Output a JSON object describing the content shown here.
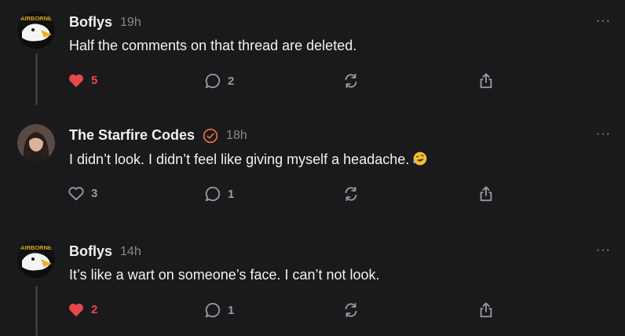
{
  "posts": [
    {
      "author": "Boflys",
      "time": "19h",
      "verified": false,
      "text": "Half the comments on that thread are deleted.",
      "avatar": {
        "type": "logo",
        "text": "AIRBORNE",
        "icon": "eagle-icon"
      },
      "likes": "5",
      "liked": true,
      "comments": "2",
      "emoji": null
    },
    {
      "author": "The Starfire Codes",
      "time": "18h",
      "verified": true,
      "text": "I didn’t look. I didn’t feel like giving myself a headache.",
      "avatar": {
        "type": "photo",
        "icon": "user-photo"
      },
      "likes": "3",
      "liked": false,
      "comments": "1",
      "emoji": "rolling-on-floor-laughing-emoji"
    },
    {
      "author": "Boflys",
      "time": "14h",
      "verified": false,
      "text": "It’s like a wart on someone’s face. I can’t not look.",
      "avatar": {
        "type": "logo",
        "text": "AIRBORNE",
        "icon": "eagle-icon"
      },
      "likes": "2",
      "liked": true,
      "comments": "1",
      "emoji": null
    }
  ],
  "more_label": "···",
  "colors": {
    "background": "#1a1a1c",
    "like_active": "#e8474b",
    "verified": "#e8703a",
    "icon_muted": "#9a9aa0"
  }
}
